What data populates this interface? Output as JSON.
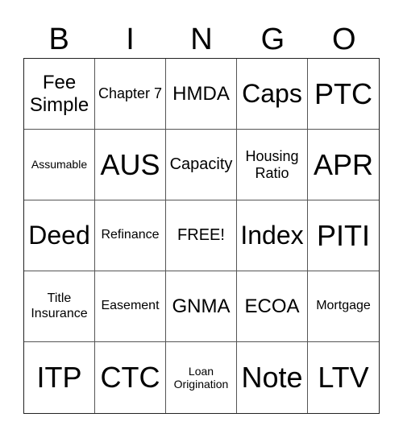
{
  "header": [
    "B",
    "I",
    "N",
    "G",
    "O"
  ],
  "cells": [
    {
      "text": "Fee Simple",
      "size": "s-m2"
    },
    {
      "text": "Chapter 7",
      "size": "s-s"
    },
    {
      "text": "HMDA",
      "size": "s-m2"
    },
    {
      "text": "Caps",
      "size": "s-l"
    },
    {
      "text": "PTC",
      "size": "s-xl"
    },
    {
      "text": "Assumable",
      "size": "s-xxs"
    },
    {
      "text": "AUS",
      "size": "s-xl"
    },
    {
      "text": "Capacity",
      "size": "s-m"
    },
    {
      "text": "Housing Ratio",
      "size": "s-s"
    },
    {
      "text": "APR",
      "size": "s-xl"
    },
    {
      "text": "Deed",
      "size": "s-l"
    },
    {
      "text": "Refinance",
      "size": "s-xs"
    },
    {
      "text": "FREE!",
      "size": "s-m"
    },
    {
      "text": "Index",
      "size": "s-l"
    },
    {
      "text": "PITI",
      "size": "s-xl"
    },
    {
      "text": "Title Insurance",
      "size": "s-xs"
    },
    {
      "text": "Easement",
      "size": "s-xs"
    },
    {
      "text": "GNMA",
      "size": "s-m2"
    },
    {
      "text": "ECOA",
      "size": "s-m2"
    },
    {
      "text": "Mortgage",
      "size": "s-xs"
    },
    {
      "text": "ITP",
      "size": "s-xl"
    },
    {
      "text": "CTC",
      "size": "s-xl"
    },
    {
      "text": "Loan Origination",
      "size": "s-xxs"
    },
    {
      "text": "Note",
      "size": "s-xl"
    },
    {
      "text": "LTV",
      "size": "s-xl"
    }
  ]
}
